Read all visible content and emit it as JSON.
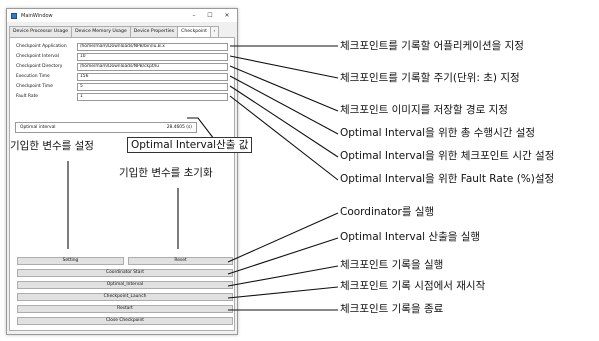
{
  "window": {
    "title": "MainWindow",
    "controls": {
      "minimize": "–",
      "maximize": "☐",
      "close": "✕"
    }
  },
  "tabs": [
    {
      "label": "Device Processor Usage",
      "active": false
    },
    {
      "label": "Device Memory Usage",
      "active": false
    },
    {
      "label": "Device Properties",
      "active": false
    },
    {
      "label": "Checkpoint",
      "active": true
    }
  ],
  "tab_scroll_label": "‹",
  "fields": [
    {
      "label": "Checkpoint Application",
      "value": "/home/mam/Downloads/NPB/bin/lu.B.x"
    },
    {
      "label": "Checkpoint Interval",
      "value": "10"
    },
    {
      "label": "Checkpoint Directory",
      "value": "/home/mam/Downloads/NPB/ckpt/lu"
    },
    {
      "label": "Execution Time",
      "value": "156"
    },
    {
      "label": "Checkpoint Time",
      "value": "5"
    },
    {
      "label": "Fault Rate",
      "value": "1"
    }
  ],
  "optimal": {
    "label": "Optimal interval",
    "value": "28.4605 (s)"
  },
  "buttons": {
    "setting": "Setting",
    "reset": "Reset",
    "coordinator_start": "Coordinator Start",
    "optimal_interval": "Optimal_Interval",
    "checkpoint_launch": "Checkpoint_Launch",
    "restart": "Restart",
    "close_checkpoint": "Close Checkpoint"
  },
  "annotations": {
    "app": "체크포인트를 기록할 어플리케이션을 지정",
    "interval": "체크포인트를 기록할 주기(단위: 초) 지정",
    "directory": "체크포인트 이미지를 저장할 경로 지정",
    "exec_time": "Optimal Interval을 위한 총 수행시간 설정",
    "ckpt_time": "Optimal Interval을 위한 체크포인트 시간 설정",
    "fault_rate": "Optimal Interval을 위한 Fault Rate (%)설정",
    "setting": "기입한 변수를 설정",
    "optimal_value": "Optimal Interval산출 값",
    "reset": "기입한 변수를 초기화",
    "coordinator": "Coordinator를 실행",
    "optimal_calc": "Optimal Interval 산출을 실행",
    "launch": "체크포인트 기록을 실행",
    "restart": "체크포인트 기록 시점에서 재시작",
    "close": "체크포인트 기록을 종료"
  }
}
